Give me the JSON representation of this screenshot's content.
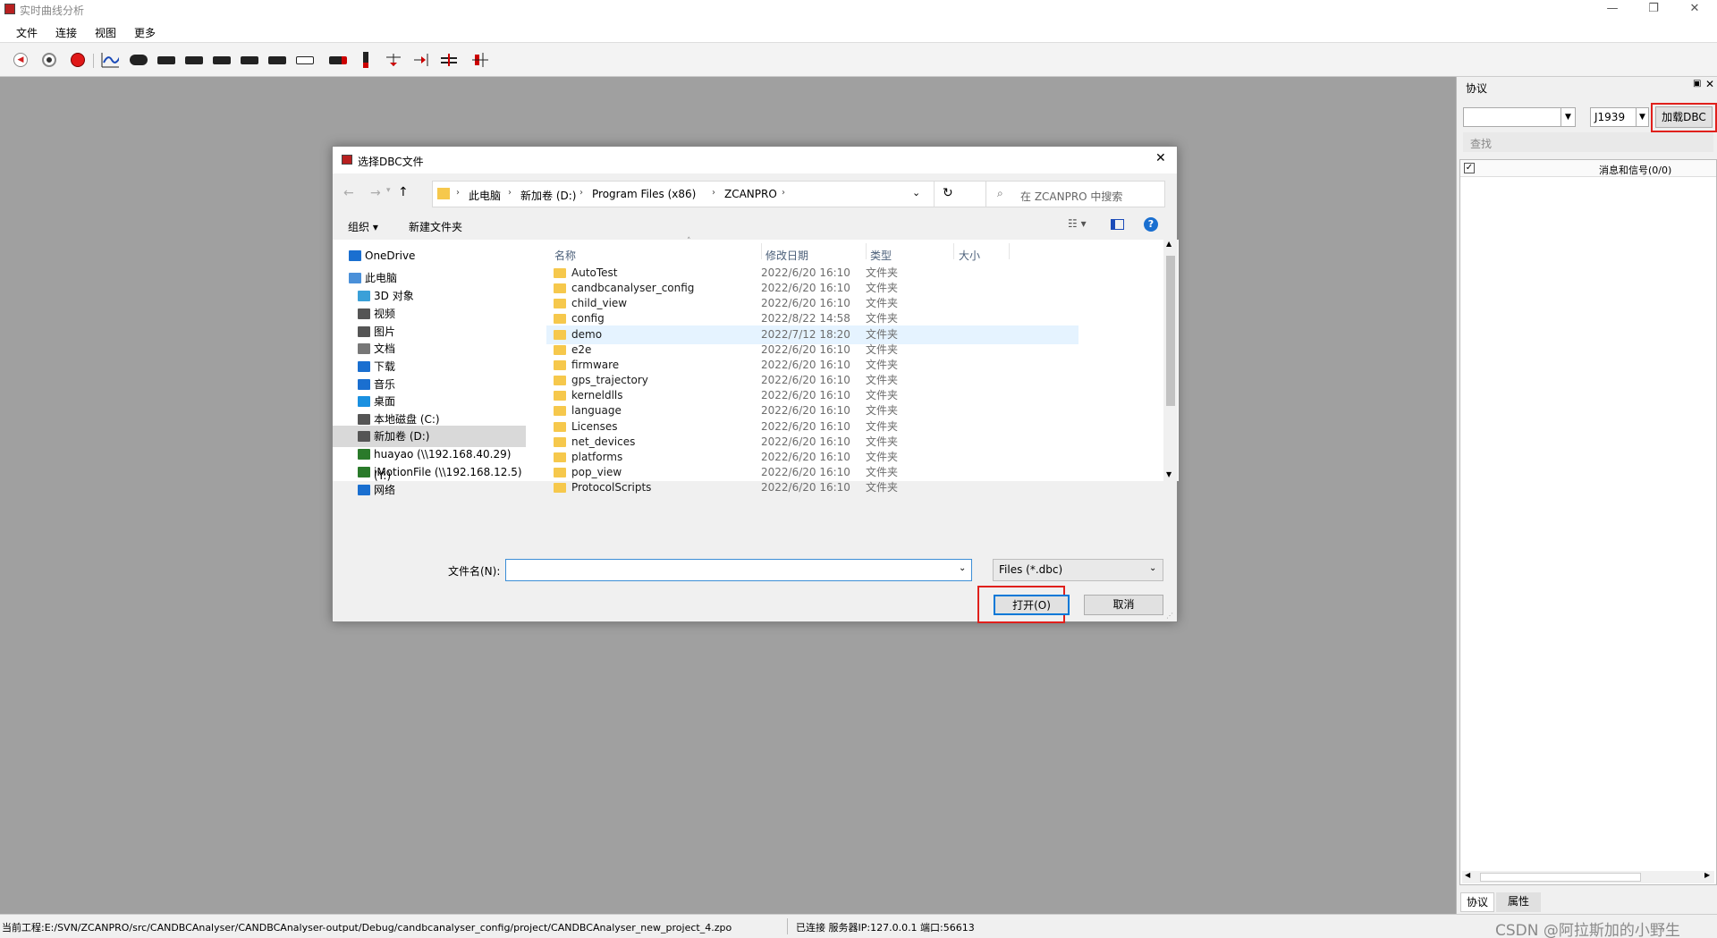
{
  "window": {
    "title": "实时曲线分析"
  },
  "menu": [
    "文件",
    "连接",
    "视图",
    "更多"
  ],
  "toolbar": {
    "icons": [
      "play-back-icon",
      "stop-record-icon",
      "record-icon",
      "curve-icon",
      "link-icon",
      "value-10-icon",
      "value-on-icon",
      "value-1-icon",
      "value-down-icon",
      "value-1100-icon",
      "value-bin-icon",
      "bar-icon",
      "marker-icon",
      "cursor-icon",
      "cursor-right-icon",
      "range-icon",
      "split-icon"
    ]
  },
  "right_panel": {
    "title": "协议",
    "protocol_value": "J1939",
    "load_dbc_label": "加载DBC",
    "search_placeholder": "查找",
    "tree_header": "消息和信号(0/0)",
    "tabs": [
      "协议",
      "属性"
    ]
  },
  "dialog": {
    "title": "选择DBC文件",
    "breadcrumb": [
      "此电脑",
      "新加卷 (D:)",
      "Program Files (x86)",
      "ZCANPRO"
    ],
    "search_placeholder": "在 ZCANPRO 中搜索",
    "organize_label": "组织 ▾",
    "new_folder_label": "新建文件夹",
    "nav": [
      {
        "label": "OneDrive",
        "icon": "cloud-icon"
      },
      {
        "label": "此电脑",
        "icon": "computer-icon"
      },
      {
        "label": "3D 对象",
        "icon": "cube-icon"
      },
      {
        "label": "视频",
        "icon": "video-icon"
      },
      {
        "label": "图片",
        "icon": "picture-icon"
      },
      {
        "label": "文档",
        "icon": "document-icon"
      },
      {
        "label": "下载",
        "icon": "download-icon"
      },
      {
        "label": "音乐",
        "icon": "music-icon"
      },
      {
        "label": "桌面",
        "icon": "desktop-icon"
      },
      {
        "label": "本地磁盘 (C:)",
        "icon": "drive-icon"
      },
      {
        "label": "新加卷 (D:)",
        "icon": "drive-icon"
      },
      {
        "label": "huayao (\\\\192.168.40.29) (Y:)",
        "icon": "network-drive-icon"
      },
      {
        "label": "iMotionFile (\\\\192.168.12.5)",
        "icon": "network-drive-icon"
      },
      {
        "label": "网络",
        "icon": "network-icon"
      }
    ],
    "columns": [
      "名称",
      "修改日期",
      "类型",
      "大小"
    ],
    "files": [
      {
        "name": "AutoTest",
        "date": "2022/6/20 16:10",
        "type": "文件夹"
      },
      {
        "name": "candbcanalyser_config",
        "date": "2022/6/20 16:10",
        "type": "文件夹"
      },
      {
        "name": "child_view",
        "date": "2022/6/20 16:10",
        "type": "文件夹"
      },
      {
        "name": "config",
        "date": "2022/8/22 14:58",
        "type": "文件夹"
      },
      {
        "name": "demo",
        "date": "2022/7/12 18:20",
        "type": "文件夹"
      },
      {
        "name": "e2e",
        "date": "2022/6/20 16:10",
        "type": "文件夹"
      },
      {
        "name": "firmware",
        "date": "2022/6/20 16:10",
        "type": "文件夹"
      },
      {
        "name": "gps_trajectory",
        "date": "2022/6/20 16:10",
        "type": "文件夹"
      },
      {
        "name": "kerneldlls",
        "date": "2022/6/20 16:10",
        "type": "文件夹"
      },
      {
        "name": "language",
        "date": "2022/6/20 16:10",
        "type": "文件夹"
      },
      {
        "name": "Licenses",
        "date": "2022/6/20 16:10",
        "type": "文件夹"
      },
      {
        "name": "net_devices",
        "date": "2022/6/20 16:10",
        "type": "文件夹"
      },
      {
        "name": "platforms",
        "date": "2022/6/20 16:10",
        "type": "文件夹"
      },
      {
        "name": "pop_view",
        "date": "2022/6/20 16:10",
        "type": "文件夹"
      },
      {
        "name": "ProtocolScripts",
        "date": "2022/6/20 16:10",
        "type": "文件夹"
      }
    ],
    "filename_label": "文件名(N):",
    "filename_value": "",
    "filter_value": "Files (*.dbc)",
    "open_label": "打开(O)",
    "cancel_label": "取消"
  },
  "status": {
    "project": "当前工程:E:/SVN/ZCANPRO/src/CANDBCAnalyser/CANDBCAnalyser-output/Debug/candbcanalyser_config/project/CANDBCAnalyser_new_project_4.zpo",
    "connection": "已连接 服务器IP:127.0.0.1 端口:56613",
    "watermark": "CSDN @阿拉斯加的小野生"
  },
  "colors": {
    "highlight_red": "#e0201c",
    "selected_row": "#e5f3ff",
    "accent_blue": "#0078d7"
  }
}
